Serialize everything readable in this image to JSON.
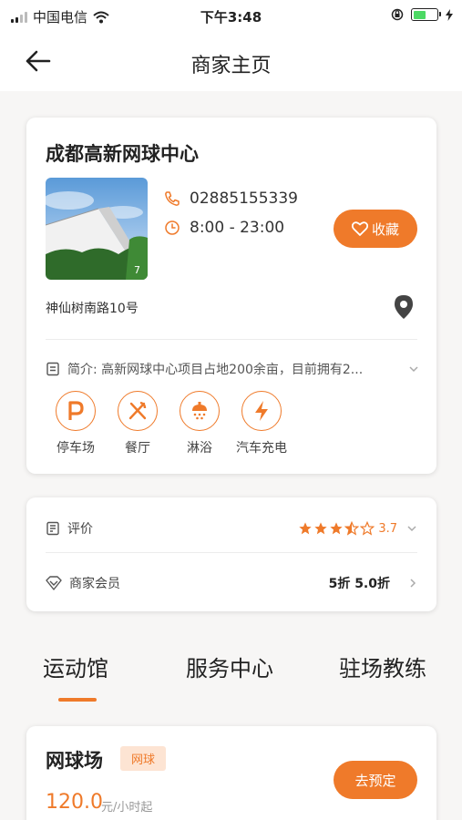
{
  "status_bar": {
    "carrier": "中国电信",
    "time": "下午3:48"
  },
  "nav": {
    "title": "商家主页"
  },
  "venue": {
    "name": "成都高新网球中心",
    "photo_count": "7",
    "phone": "02885155339",
    "hours": "8:00 - 23:00",
    "favorite_label": "收藏",
    "address": "神仙树南路10号",
    "intro": "简介: 高新网球中心项目占地200余亩，目前拥有2...",
    "amenities": [
      {
        "label": "停车场",
        "icon": "parking-icon"
      },
      {
        "label": "餐厅",
        "icon": "restaurant-icon"
      },
      {
        "label": "淋浴",
        "icon": "shower-icon"
      },
      {
        "label": "汽车充电",
        "icon": "charging-icon"
      }
    ]
  },
  "review": {
    "label": "评价",
    "rating": "3.7",
    "stars": 3.5
  },
  "membership": {
    "label": "商家会员",
    "discount": "5折 5.0折"
  },
  "tabs": [
    {
      "label": "运动馆"
    },
    {
      "label": "服务中心"
    },
    {
      "label": "驻场教练"
    }
  ],
  "court": {
    "name": "网球场",
    "tag": "网球",
    "price": "120.0",
    "unit": "元/小时起",
    "book_label": "去预定"
  },
  "colors": {
    "accent": "#ef7a2a",
    "tag_bg": "#fde4d3"
  }
}
